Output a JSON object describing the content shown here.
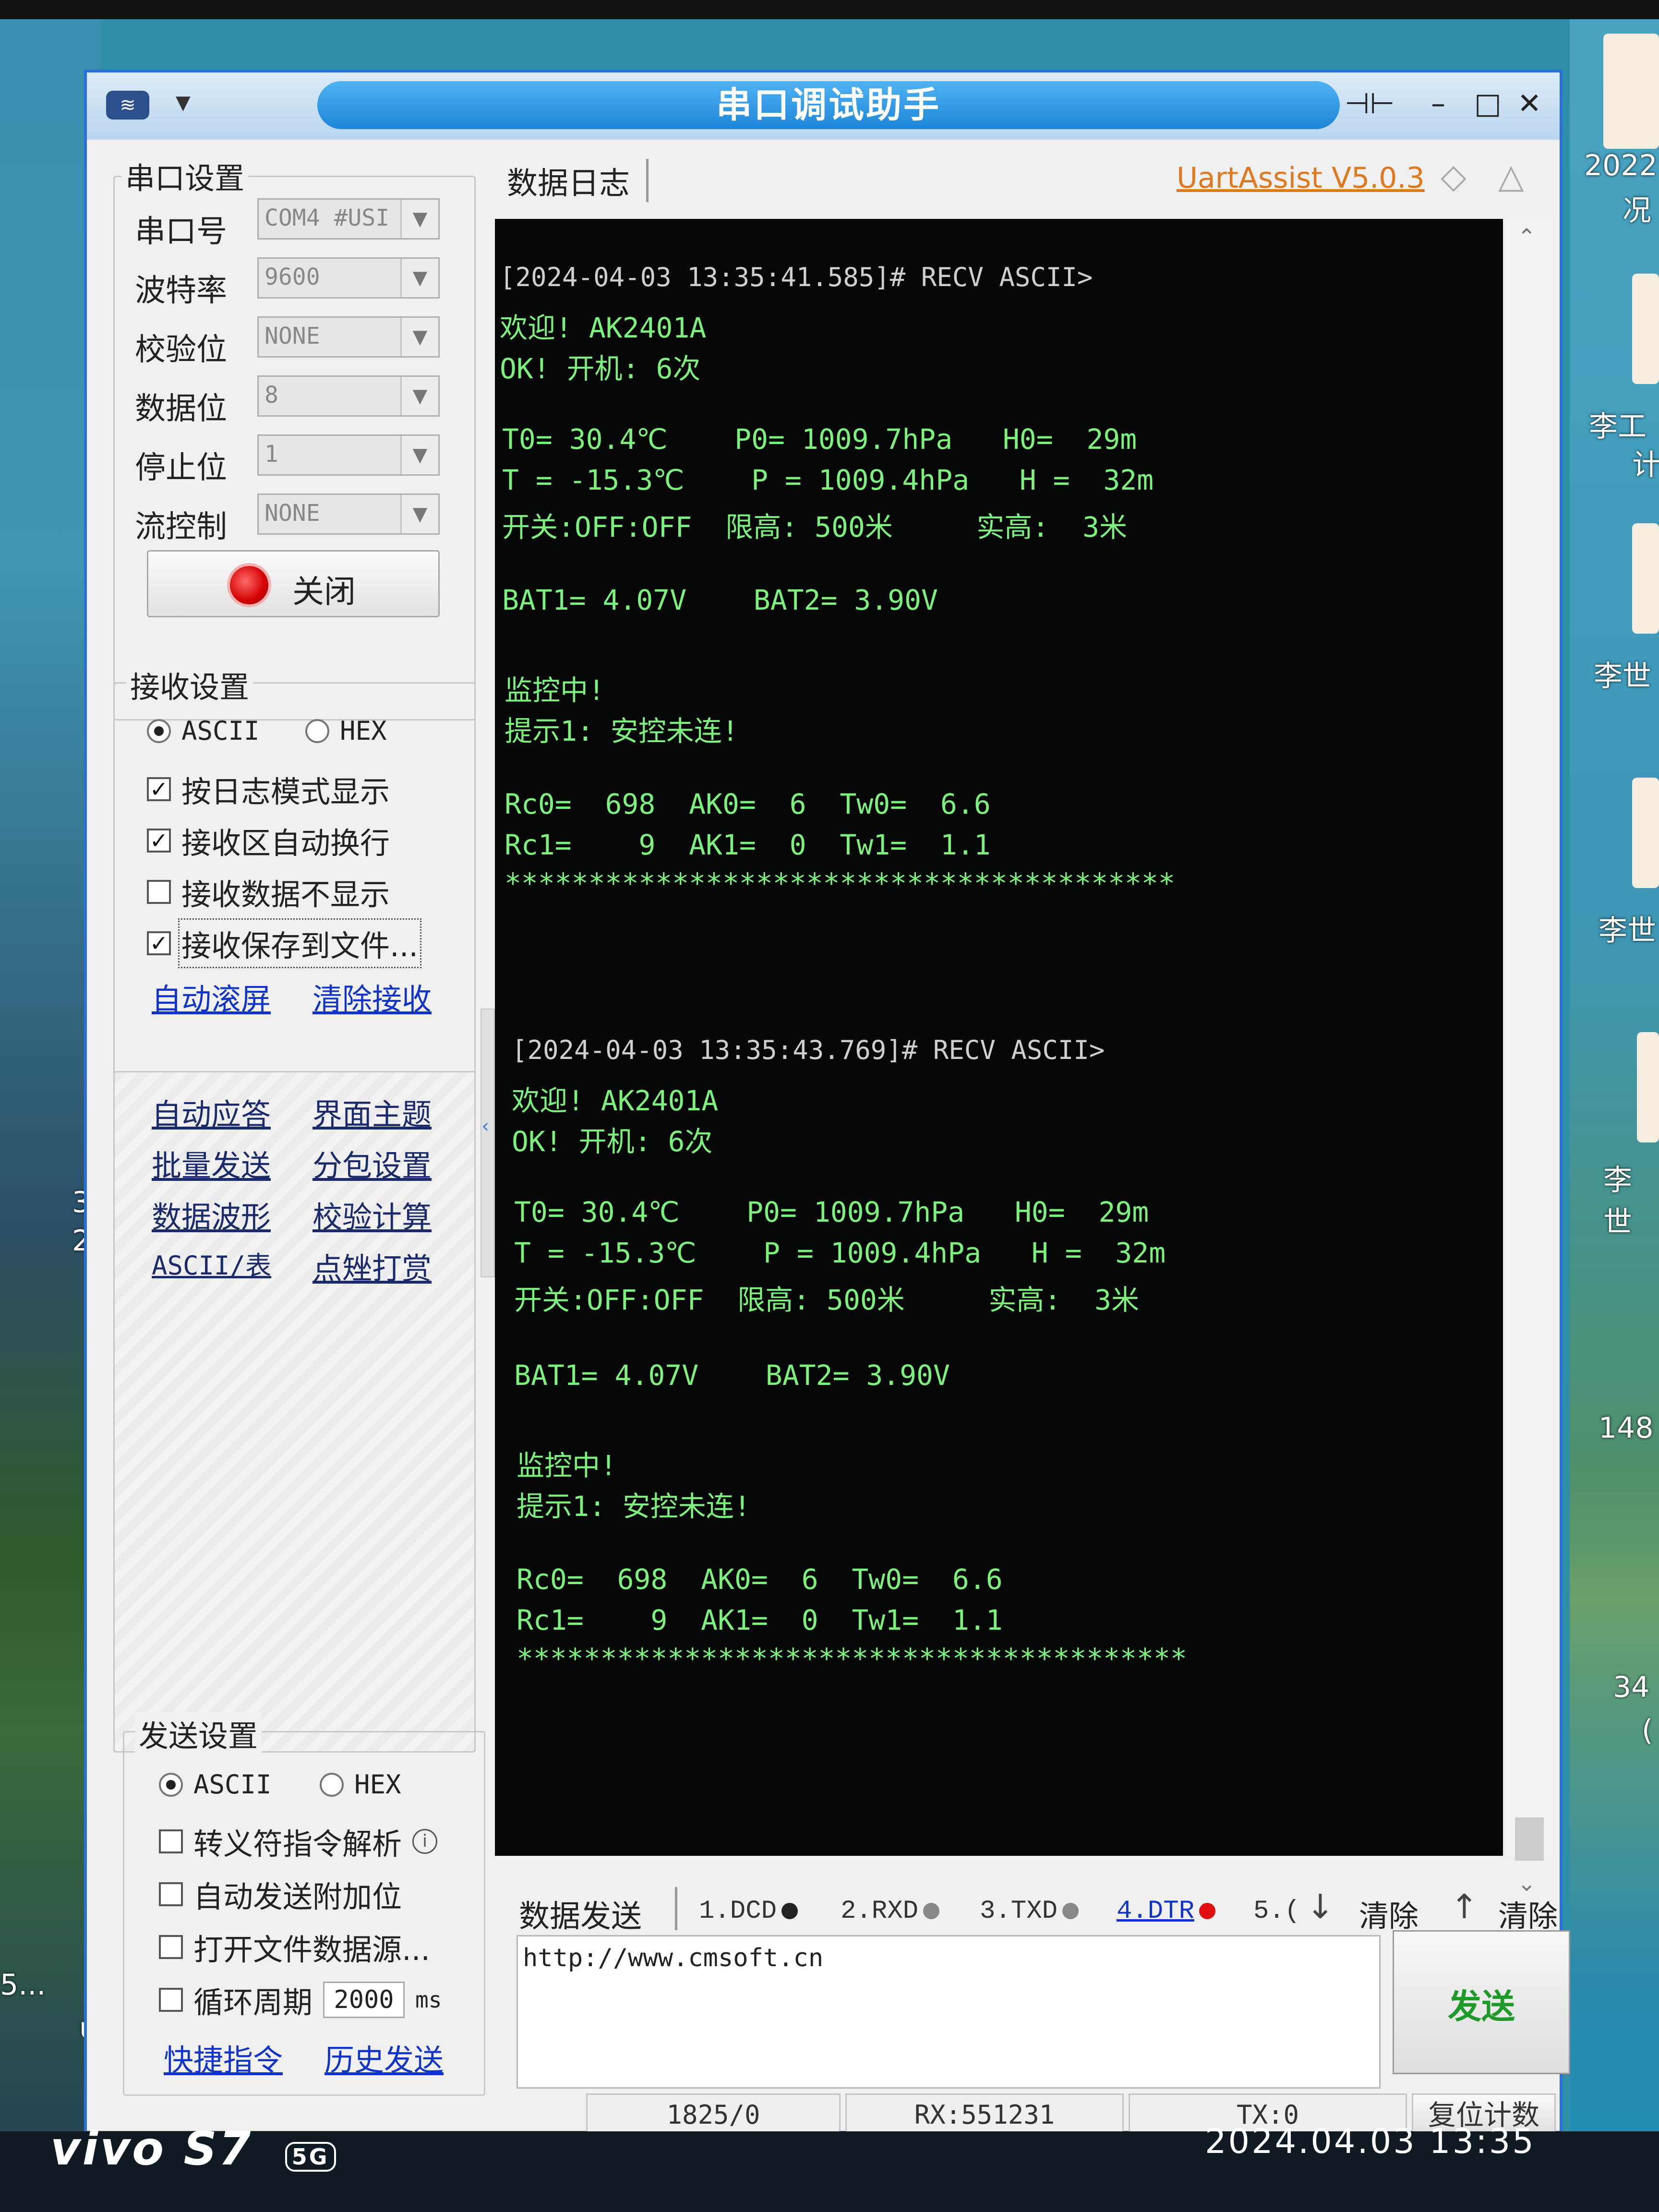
{
  "window": {
    "title": "串口调试助手",
    "controls": [
      "–",
      "□",
      "✕"
    ],
    "pin_icon": "pin-icon"
  },
  "serial_settings": {
    "title": "串口设置",
    "port_label": "串口号",
    "port_value": "COM4 #USI",
    "baud_label": "波特率",
    "baud_value": "9600",
    "parity_label": "校验位",
    "parity_value": "NONE",
    "databits_label": "数据位",
    "databits_value": "8",
    "stopbits_label": "停止位",
    "stopbits_value": "1",
    "flow_label": "流控制",
    "flow_value": "NONE",
    "close_button": "关闭"
  },
  "receive_settings": {
    "title": "接收设置",
    "ascii": "ASCII",
    "hex": "HEX",
    "log_mode": "按日志模式显示",
    "auto_wrap": "接收区自动换行",
    "hide_data": "接收数据不显示",
    "save_file": "接收保存到文件...",
    "auto_scroll": "自动滚屏",
    "clear_receive": "清除接收"
  },
  "tools": {
    "auto_reply": "自动应答",
    "theme": "界面主题",
    "batch_send": "批量发送",
    "packet_settings": "分包设置",
    "waveform": "数据波形",
    "checksum": "校验计算",
    "ascii_table": "ASCII/表",
    "matrix": "点矬打赏"
  },
  "send_settings": {
    "title": "发送设置",
    "ascii": "ASCII",
    "hex": "HEX",
    "escape": "转义符指令解析",
    "append_check": "自动发送附加位",
    "open_file": "打开文件数据源...",
    "loop": "循环周期",
    "loop_value": "2000",
    "loop_unit": "ms",
    "shortcuts": "快捷指令",
    "history": "历史发送"
  },
  "log": {
    "tab": "数据日志",
    "brand": "UartAssist V5.0.3",
    "lines": [
      "[2024-04-03 13:35:41.585]# RECV ASCII>",
      "欢迎! AK2401A",
      "OK! 开机: 6次",
      "T0= 30.4℃    P0= 1009.7hPa   H0=  29m",
      "T = -15.3℃    P = 1009.4hPa   H =  32m",
      "开关:OFF:OFF  限高: 500米     实高:  3米",
      "BAT1= 4.07V    BAT2= 3.90V",
      "监控中!",
      "提示1: 安控未连!",
      "Rc0=  698  AK0=  6  Tw0=  6.6",
      "Rc1=    9  AK1=  0  Tw1=  1.1",
      "****************************************",
      "[2024-04-03 13:35:43.769]# RECV ASCII>",
      "欢迎! AK2401A",
      "OK! 开机: 6次",
      "T0= 30.4℃    P0= 1009.7hPa   H0=  29m",
      "T = -15.3℃    P = 1009.4hPa   H =  32m",
      "开关:OFF:OFF  限高: 500米     实高:  3米",
      "BAT1= 4.07V    BAT2= 3.90V",
      "监控中!",
      "提示1: 安控未连!",
      "Rc0=  698  AK0=  6  Tw0=  6.6",
      "Rc1=    9  AK1=  0  Tw1=  1.1",
      "****************************************"
    ]
  },
  "send_area": {
    "tab": "数据发送",
    "signals": [
      "1.DCD",
      "2.RXD",
      "3.TXD",
      "4.DTR",
      "5.("
    ],
    "clear1": "清除",
    "clear2": "清除",
    "input_value": "http://www.cmsoft.cn",
    "send_button": "发送"
  },
  "status": {
    "counter": "1825/0",
    "rx": "RX:551231",
    "tx": "TX:0",
    "reset": "复位计数"
  },
  "desktop": {
    "right_labels": [
      "2022",
      "况",
      "李工",
      "计",
      "李世",
      "李世",
      "李世",
      "148",
      "34",
      "("
    ],
    "left_labels": [
      "3",
      "2",
      "5...",
      "u"
    ]
  },
  "photo_watermark": {
    "device": "vivo S7",
    "network": "5G",
    "datetime": "2024.04.03 13:35"
  },
  "colors": {
    "terminal_bg": "#050707",
    "terminal_text": "#7cf27c",
    "title_accent": "#1e86d8",
    "link": "#1234c8",
    "brand": "#e07820",
    "send_button_text": "#1f9a2a"
  }
}
